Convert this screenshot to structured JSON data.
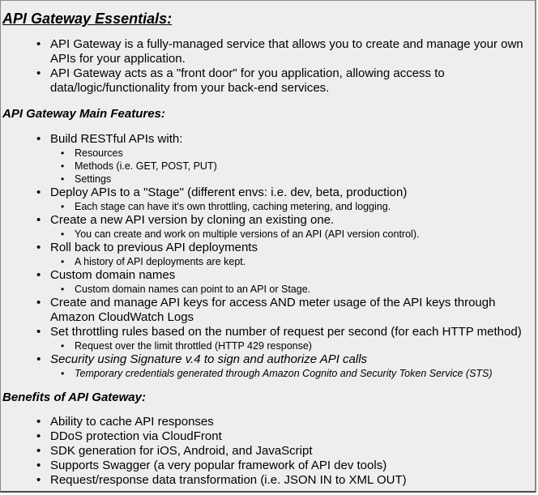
{
  "essentials": {
    "heading": "API Gateway Essentials:",
    "items": [
      "API Gateway is a fully-managed service that allows you to create and manage your own APIs for your application.",
      "API Gateway acts as a \"front door\" for you application, allowing access to data/logic/functionality from your back-end services."
    ]
  },
  "features": {
    "heading": "API Gateway Main Features:",
    "items": [
      {
        "text": "Build RESTful APIs with:",
        "sub": [
          "Resources",
          "Methods (i.e. GET, POST, PUT)",
          "Settings"
        ]
      },
      {
        "text": "Deploy APIs to a \"Stage\" (different envs: i.e. dev, beta, production)",
        "sub": [
          "Each stage can have it's own throttling, caching metering, and logging."
        ]
      },
      {
        "text": "Create a new API version by cloning an existing one.",
        "sub": [
          "You can create and work on multiple versions of an API (API version control)."
        ]
      },
      {
        "text": "Roll back to previous API deployments",
        "sub": [
          "A history of API deployments are kept."
        ]
      },
      {
        "text": "Custom domain names",
        "sub": [
          "Custom domain names can point to an API or Stage."
        ]
      },
      {
        "text": "Create and manage API keys for access AND meter usage of the API keys through Amazon CloudWatch Logs",
        "sub": []
      },
      {
        "text": "Set throttling rules based on the number of request per second (for each HTTP method)",
        "sub": [
          "Request over the limit throttled (HTTP 429 response)"
        ]
      },
      {
        "text": "Security using Signature v.4 to sign and authorize API calls",
        "sub": [
          "Temporary credentials generated through Amazon Cognito and Security Token Service (STS)"
        ]
      }
    ]
  },
  "benefits": {
    "heading": "Benefits of API Gateway:",
    "items": [
      "Ability to cache API responses",
      "DDoS protection via CloudFront",
      "SDK generation for iOS, Android, and JavaScript",
      "Supports Swagger (a very popular framework of API dev tools)",
      "Request/response data transformation (i.e. JSON IN to XML OUT)"
    ]
  }
}
